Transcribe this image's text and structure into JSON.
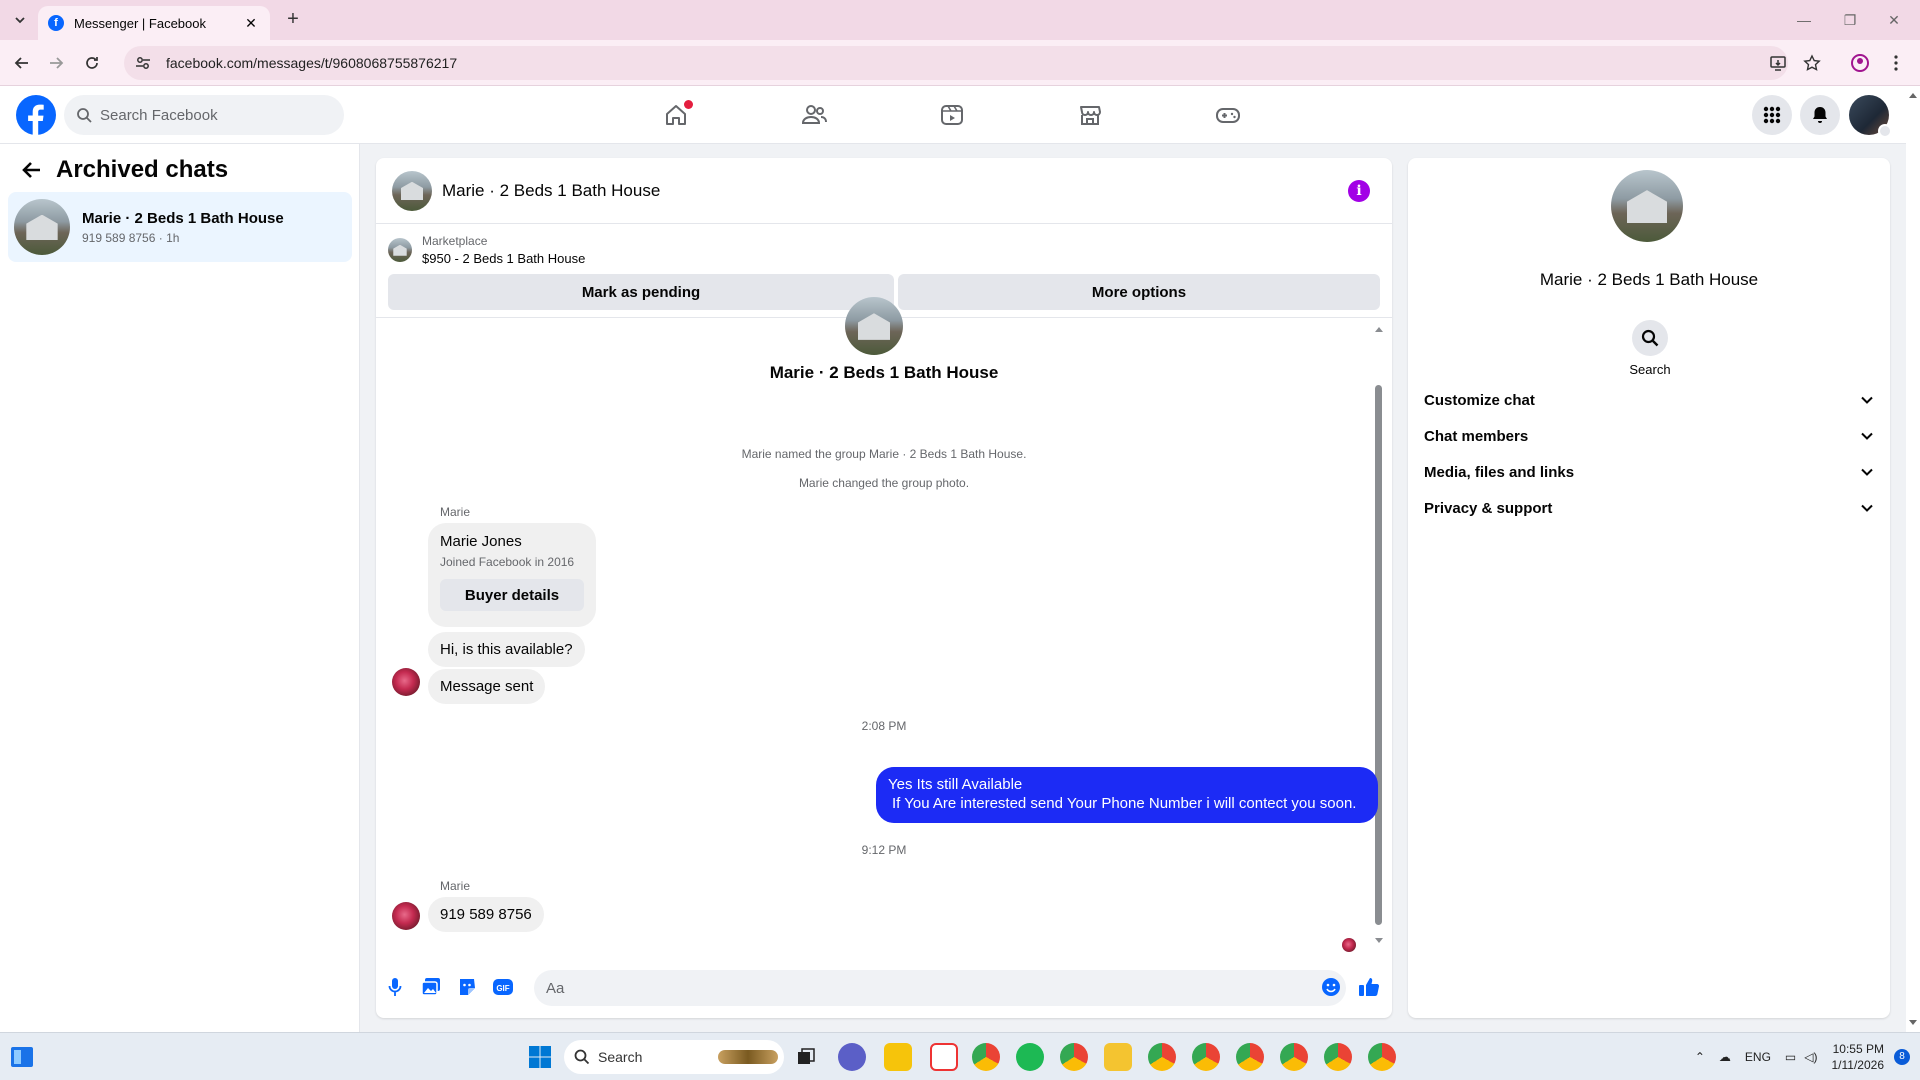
{
  "browser": {
    "tab_title": "Messenger | Facebook",
    "url": "facebook.com/messages/t/9608068755876217"
  },
  "fb_header": {
    "search_placeholder": "Search Facebook",
    "nav_tabs": [
      "home-icon",
      "friends-icon",
      "video-icon",
      "marketplace-icon",
      "gaming-icon"
    ],
    "right_icons": [
      "menu-grid-icon",
      "notifications-icon",
      "profile-avatar"
    ],
    "accent_color": "#0866ff"
  },
  "sidebar": {
    "title": "Archived chats",
    "chats": [
      {
        "name": "Marie · 2 Beds 1 Bath House",
        "preview": "919 589 8756 · 1h"
      }
    ]
  },
  "conversation": {
    "title": "Marie · 2 Beds 1 Bath House",
    "marketplace": {
      "label": "Marketplace",
      "listing": "$950 - 2 Beds 1 Bath House",
      "buttons": [
        "Mark as pending",
        "More options"
      ]
    },
    "thread_title": "Marie · 2 Beds 1 Bath House",
    "system_notes": [
      "Marie named the group Marie · 2 Beds 1 Bath House.",
      "Marie changed the group photo."
    ],
    "buyer_card": {
      "sender": "Marie",
      "name": "Marie Jones",
      "joined": "Joined Facebook in 2016",
      "button": "Buyer details"
    },
    "messages": [
      {
        "from": "Marie",
        "text": "Hi, is this available?"
      },
      {
        "from": "Marie",
        "text": "Message sent"
      },
      {
        "time": "2:08 PM"
      },
      {
        "from": "me",
        "line1": "Yes Its still Available",
        "line2": "If You Are interested send Your Phone Number i will contect you soon."
      },
      {
        "time": "9:12 PM"
      },
      {
        "from": "Marie",
        "sender_label": "Marie",
        "text": "919 589 8756"
      }
    ],
    "composer_placeholder": "Aa",
    "outgoing_bubble_color": "#1c2bf5"
  },
  "details": {
    "name": "Marie · 2 Beds 1 Bath House",
    "search_label": "Search",
    "sections": [
      "Customize chat",
      "Chat members",
      "Media, files and links",
      "Privacy & support"
    ]
  },
  "taskbar": {
    "search_label": "Search",
    "language": "ENG",
    "time": "10:55 PM",
    "date": "1/11/2026",
    "badge": "8"
  }
}
